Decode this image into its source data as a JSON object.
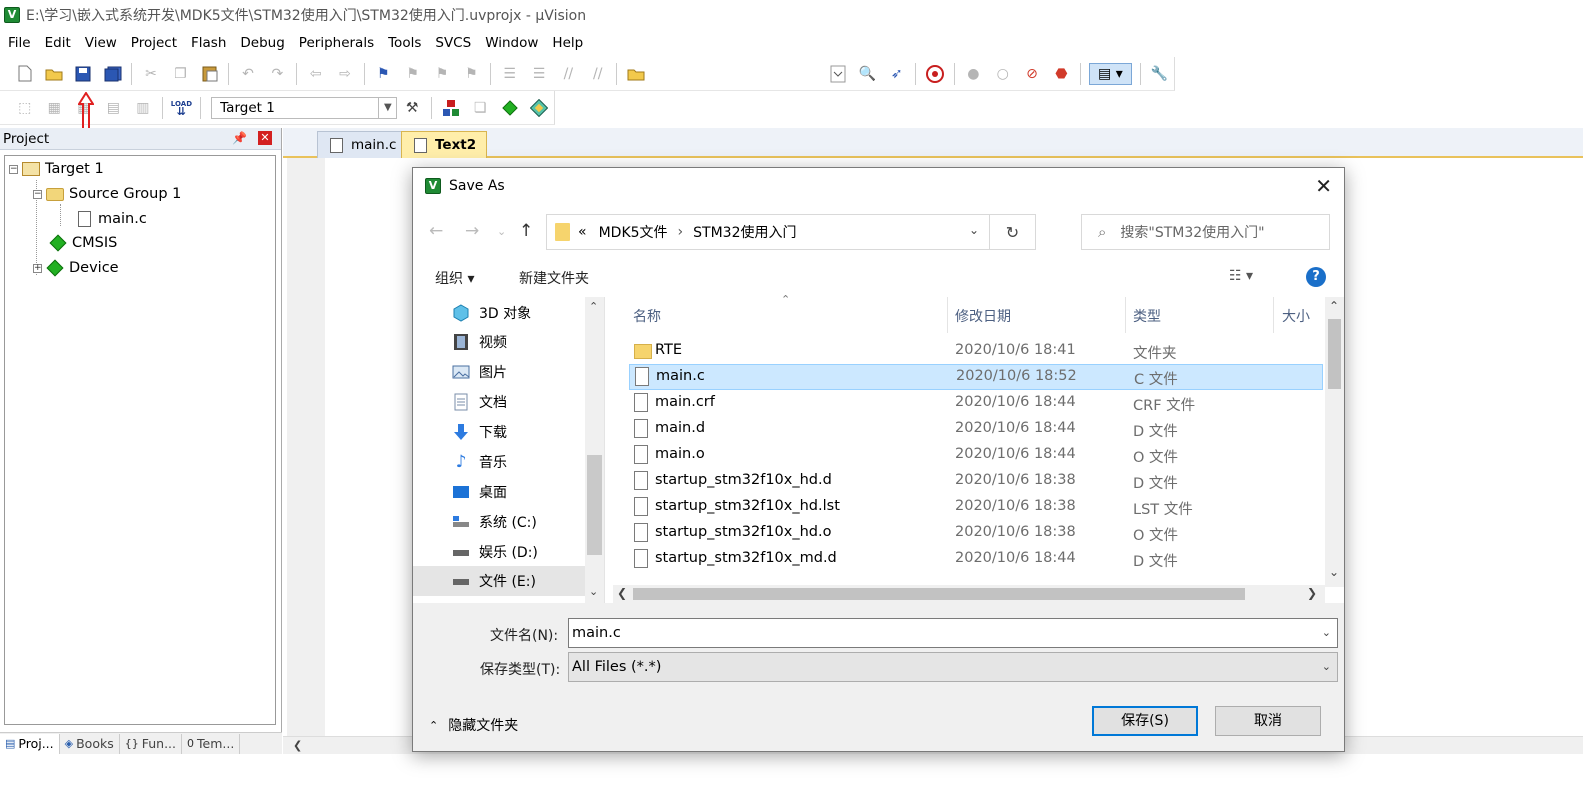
{
  "window": {
    "title": "E:\\学习\\嵌入式系统开发\\MDK5文件\\STM32使用入门\\STM32使用入门.uvprojx - µVision",
    "app_icon_letter": "V"
  },
  "menu": [
    "File",
    "Edit",
    "View",
    "Project",
    "Flash",
    "Debug",
    "Peripherals",
    "Tools",
    "SVCS",
    "Window",
    "Help"
  ],
  "toolbar2": {
    "target_select": "Target 1",
    "load_label": "LOAD"
  },
  "project_panel": {
    "title": "Project",
    "tree": {
      "target": "Target 1",
      "group": "Source Group 1",
      "file": "main.c",
      "cmsis": "CMSIS",
      "device": "Device"
    },
    "tabs": [
      "Proj...",
      "Books",
      "Fun...",
      "Tem..."
    ],
    "tab_icons": [
      "{}",
      "0"
    ]
  },
  "editor": {
    "tabs": [
      {
        "label": "main.c",
        "active": false
      },
      {
        "label": "Text2",
        "active": true
      }
    ]
  },
  "dialog": {
    "title": "Save As",
    "address": {
      "overflow": "«",
      "parts": [
        "MDK5文件",
        "STM32使用入门"
      ]
    },
    "search_placeholder": "搜索\"STM32使用入门\"",
    "commands": {
      "organize": "组织 ▾",
      "new_folder": "新建文件夹",
      "help": "?"
    },
    "nav_items": [
      {
        "label": "3D 对象",
        "icon": "cube-icon"
      },
      {
        "label": "视频",
        "icon": "video-icon"
      },
      {
        "label": "图片",
        "icon": "picture-icon"
      },
      {
        "label": "文档",
        "icon": "document-icon"
      },
      {
        "label": "下载",
        "icon": "download-icon"
      },
      {
        "label": "音乐",
        "icon": "music-icon"
      },
      {
        "label": "桌面",
        "icon": "desktop-icon"
      },
      {
        "label": "系统 (C:)",
        "icon": "system-drive-icon"
      },
      {
        "label": "娱乐 (D:)",
        "icon": "drive-icon"
      },
      {
        "label": "文件 (E:)",
        "icon": "drive-icon",
        "active": true
      }
    ],
    "columns": {
      "name": "名称",
      "date": "修改日期",
      "type": "类型",
      "size": "大小"
    },
    "files": [
      {
        "name": "RTE",
        "date": "2020/10/6 18:41",
        "type": "文件夹",
        "folder": true
      },
      {
        "name": "main.c",
        "date": "2020/10/6 18:52",
        "type": "C 文件",
        "selected": true
      },
      {
        "name": "main.crf",
        "date": "2020/10/6 18:44",
        "type": "CRF 文件"
      },
      {
        "name": "main.d",
        "date": "2020/10/6 18:44",
        "type": "D 文件"
      },
      {
        "name": "main.o",
        "date": "2020/10/6 18:44",
        "type": "O 文件"
      },
      {
        "name": "startup_stm32f10x_hd.d",
        "date": "2020/10/6 18:38",
        "type": "D 文件"
      },
      {
        "name": "startup_stm32f10x_hd.lst",
        "date": "2020/10/6 18:38",
        "type": "LST 文件"
      },
      {
        "name": "startup_stm32f10x_hd.o",
        "date": "2020/10/6 18:38",
        "type": "O 文件"
      },
      {
        "name": "startup_stm32f10x_md.d",
        "date": "2020/10/6 18:44",
        "type": "D 文件"
      }
    ],
    "filename_label": "文件名(N):",
    "filename_value": "main.c",
    "filetype_label": "保存类型(T):",
    "filetype_value": "All Files (*.*)",
    "hide_folders": "隐藏文件夹",
    "save_button": "保存(S)",
    "cancel_button": "取消"
  },
  "colors": {
    "selection": "#cce8ff",
    "accent": "#0078d7",
    "annotation": "#e02020"
  }
}
